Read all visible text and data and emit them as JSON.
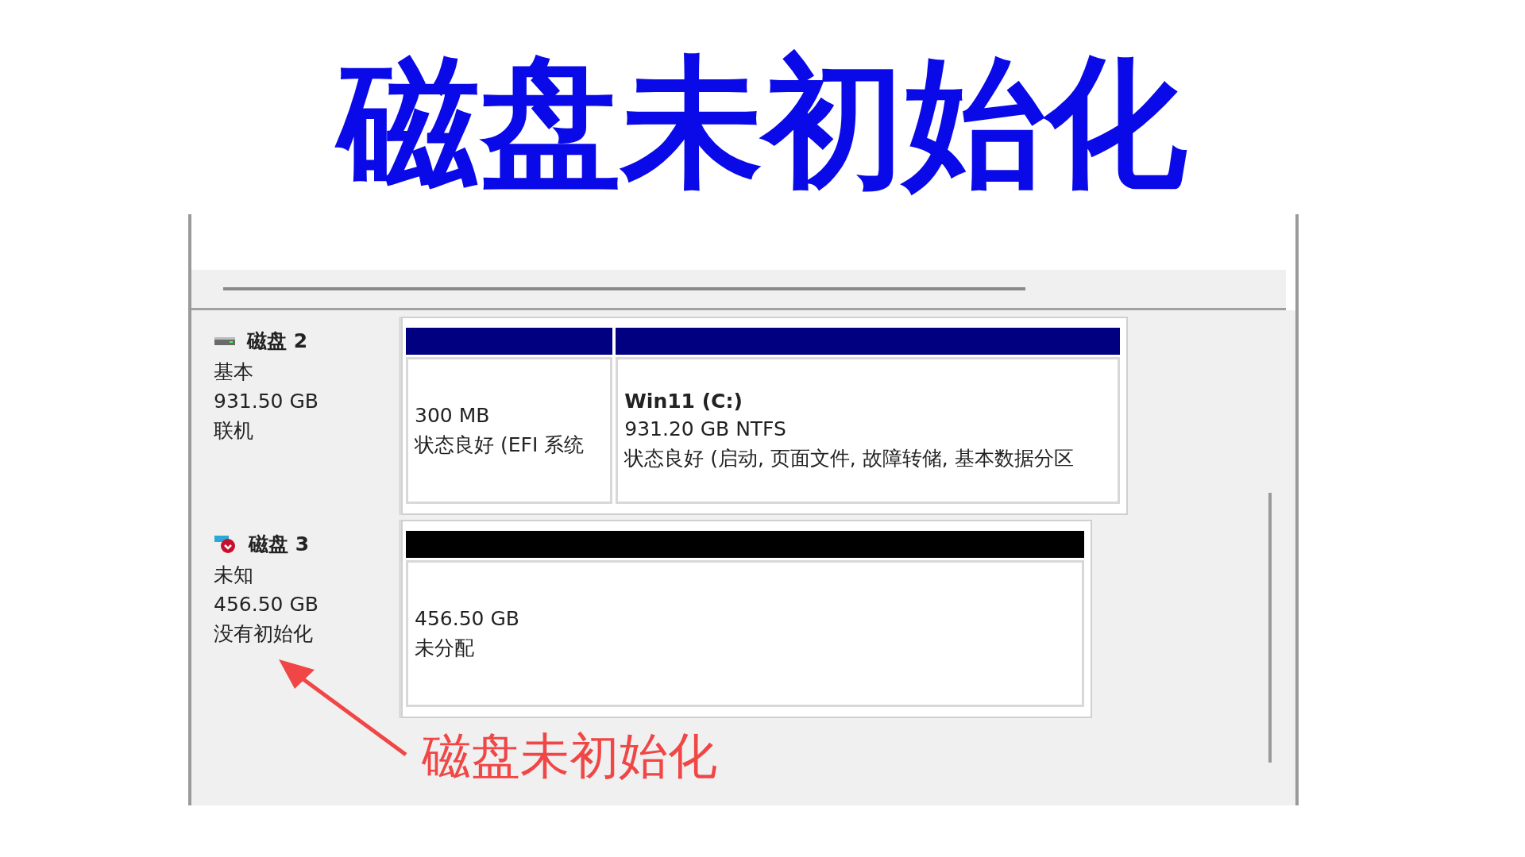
{
  "title": "磁盘未初始化",
  "disks": [
    {
      "name": "磁盘 2",
      "kind": "basic",
      "type": "基本",
      "size": "931.50 GB",
      "status": "联机",
      "partitions": [
        {
          "kind": "primary",
          "size": "300 MB",
          "status": "状态良好 (EFI 系统"
        },
        {
          "kind": "primary",
          "label": "Win11  (C:)",
          "size": "931.20 GB NTFS",
          "status": "状态良好 (启动, 页面文件, 故障转储, 基本数据分区"
        }
      ]
    },
    {
      "name": "磁盘 3",
      "kind": "uninitialized",
      "type": "未知",
      "size": "456.50 GB",
      "status": "没有初始化",
      "partitions": [
        {
          "kind": "unallocated",
          "size": "456.50 GB",
          "status": "未分配"
        }
      ]
    }
  ],
  "annotation": {
    "text": "磁盘未初始化"
  }
}
